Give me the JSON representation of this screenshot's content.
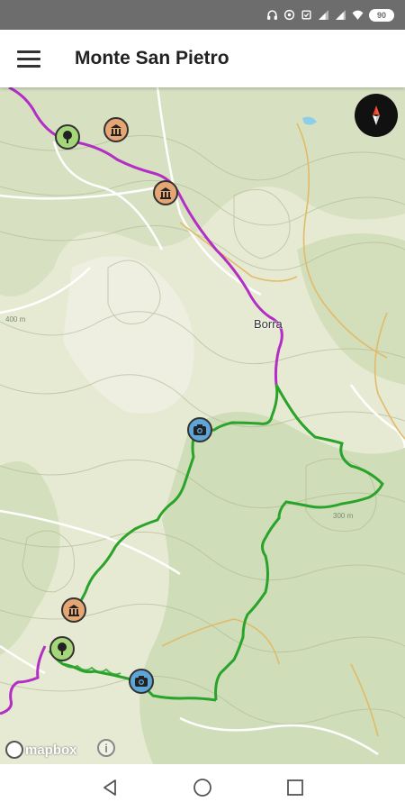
{
  "status_bar": {
    "battery": "90",
    "icons": [
      "headphones-icon",
      "location-icon",
      "alarm-icon",
      "signal-icon",
      "signal-icon",
      "wifi-icon"
    ]
  },
  "app_bar": {
    "title": "Monte San Pietro",
    "menu_icon": "hamburger-menu-icon"
  },
  "map": {
    "place_label": "Borra",
    "elevation_labels": [
      "400 m",
      "300 m"
    ],
    "attribution": "mapbox",
    "info_label": "i",
    "compass_icon": "compass-icon",
    "colors": {
      "background": "#e6ead3",
      "forest": "#c9d9b3",
      "contour": "#b8c0a0",
      "road": "#ffffff",
      "track": "#e8c67a",
      "purple_route": "#b22ec4",
      "green_route": "#29a329",
      "museum_poi": "#e6a674",
      "tree_poi": "#a6d67a",
      "photo_poi": "#5ea6d8"
    },
    "pois": [
      {
        "type": "tree",
        "icon": "tree-icon"
      },
      {
        "type": "museum",
        "icon": "museum-icon"
      },
      {
        "type": "museum",
        "icon": "museum-icon"
      },
      {
        "type": "photo",
        "icon": "camera-icon"
      },
      {
        "type": "museum",
        "icon": "museum-icon"
      },
      {
        "type": "tree",
        "icon": "tree-icon"
      },
      {
        "type": "photo",
        "icon": "camera-icon"
      }
    ]
  },
  "nav_bar": {
    "buttons": [
      "back-icon",
      "home-icon",
      "recents-icon"
    ]
  }
}
